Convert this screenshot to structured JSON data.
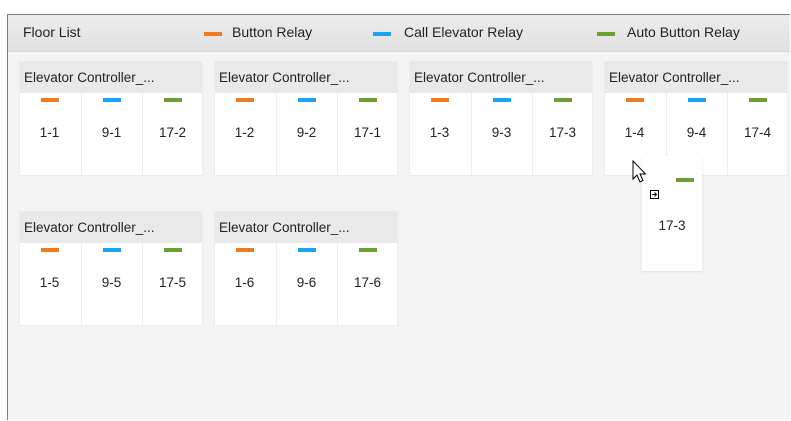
{
  "header": {
    "title": "Floor List",
    "legend": [
      {
        "label": "Button Relay",
        "color": "#f07a1e"
      },
      {
        "label": "Call Elevator Relay",
        "color": "#1aa3f0"
      },
      {
        "label": "Auto Button Relay",
        "color": "#6e9e35"
      }
    ]
  },
  "controllers": [
    {
      "title": "Elevator Controller_...",
      "floors": [
        "1-1",
        "9-1",
        "17-2"
      ]
    },
    {
      "title": "Elevator Controller_...",
      "floors": [
        "1-2",
        "9-2",
        "17-1"
      ]
    },
    {
      "title": "Elevator Controller_...",
      "floors": [
        "1-3",
        "9-3",
        "17-3"
      ]
    },
    {
      "title": "Elevator Controller_...",
      "floors": [
        "1-4",
        "9-4",
        "17-4"
      ]
    },
    {
      "title": "Elevator Controller_...",
      "floors": [
        "1-5",
        "9-5",
        "17-5"
      ]
    },
    {
      "title": "Elevator Controller_...",
      "floors": [
        "1-6",
        "9-6",
        "17-6"
      ]
    }
  ],
  "drag_item": {
    "floor": "17-3",
    "relay_color": "#6e9e35"
  }
}
